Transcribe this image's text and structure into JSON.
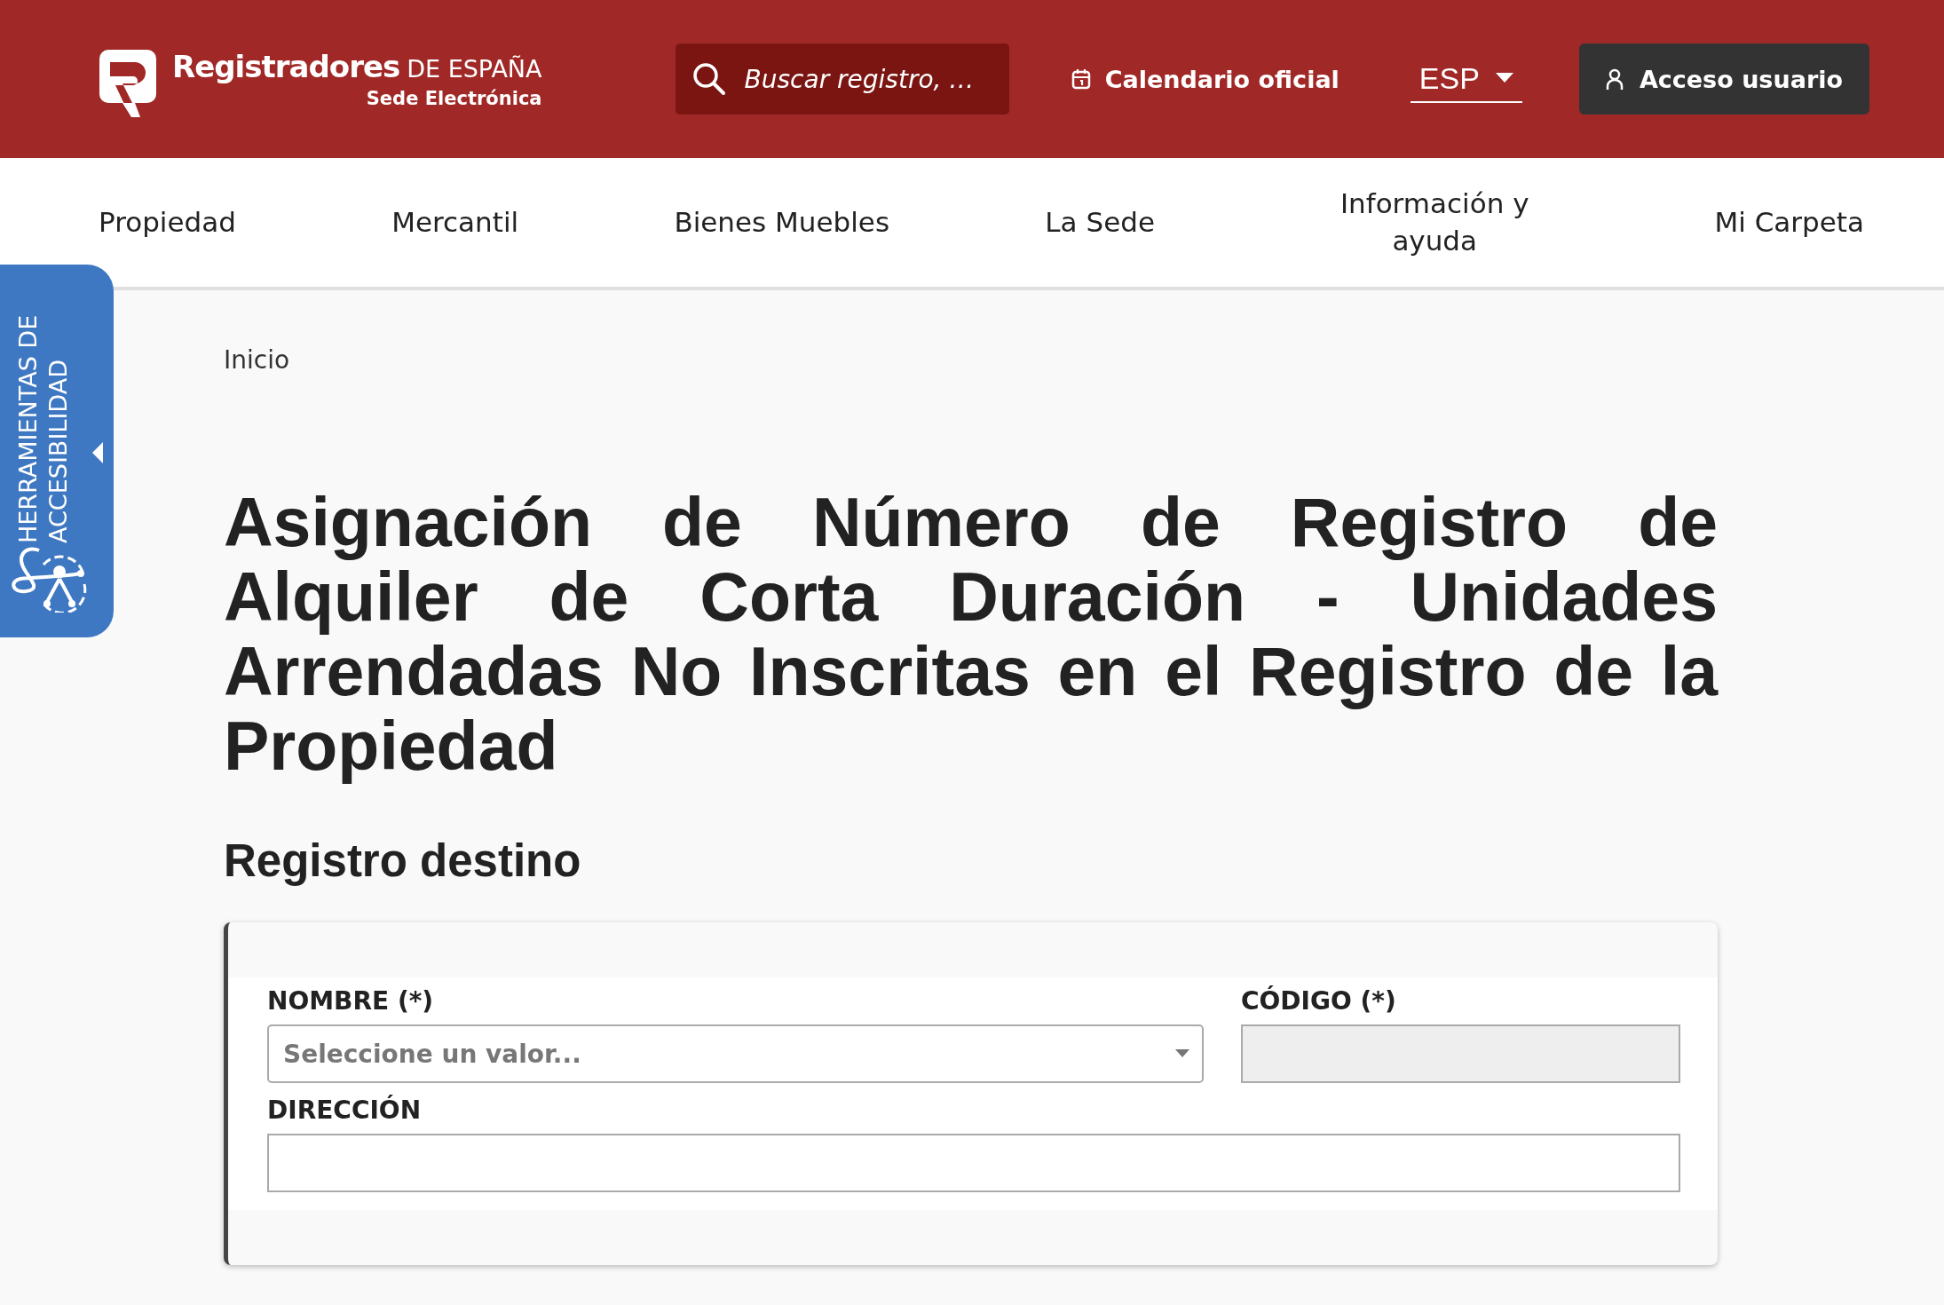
{
  "header": {
    "logo": {
      "name": "Registradores",
      "suffix": "DE ESPAÑA",
      "subtitle": "Sede Electrónica"
    },
    "search": {
      "placeholder": "Buscar registro, …"
    },
    "calendar_link": "Calendario oficial",
    "language": "ESP",
    "login_button": "Acceso usuario"
  },
  "nav": {
    "items": [
      {
        "label": "Propiedad"
      },
      {
        "label": "Mercantil"
      },
      {
        "label": "Bienes Muebles"
      },
      {
        "label": "La Sede"
      },
      {
        "label": "Información y ayuda"
      },
      {
        "label": "Mi Carpeta"
      }
    ]
  },
  "accessibility_tab": {
    "label": "HERRAMIENTAS DE ACCESIBILIDAD",
    "expanded": false
  },
  "breadcrumb": [
    "Inicio"
  ],
  "title": "Asignación de Número de Registro de Alquiler de Corta Duración - Unidades Arrendadas No Inscritas en el Registro de la Propiedad",
  "section": {
    "heading": "Registro destino",
    "fields": [
      {
        "label": "NOMBRE (*)",
        "kind": "select",
        "placeholder": "Seleccione un valor...",
        "disabled": false,
        "full_width": false
      },
      {
        "label": "CÓDIGO (*)",
        "kind": "text",
        "disabled": true,
        "full_width": false
      },
      {
        "label": "DIRECCIÓN",
        "kind": "text",
        "disabled": false,
        "full_width": true
      }
    ]
  }
}
